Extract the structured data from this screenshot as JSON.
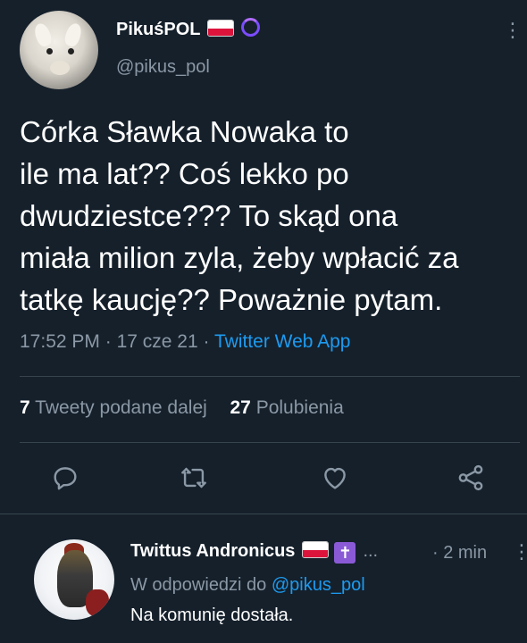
{
  "main_tweet": {
    "author_name": "PikuśPOL",
    "handle": "@pikus_pol",
    "text_lines": [
      "Córka Sławka Nowaka to",
      "ile ma lat?? Coś lekko po",
      "dwudziestce??? To skąd ona",
      "miała milion zyla, żeby wpłacić za",
      "tatkę kaucję?? Poważnie pytam."
    ],
    "time": "17:52 PM",
    "date": "17 cze 21",
    "source_app": "Twitter Web App",
    "separator": "·",
    "retweets_count": "7",
    "retweets_label": "Tweety podane dalej",
    "likes_count": "27",
    "likes_label": "Polubienia"
  },
  "icons": {
    "reply": "reply-icon",
    "retweet": "retweet-icon",
    "like": "heart-icon",
    "share": "share-icon",
    "more": "more-icon",
    "flag": "poland-flag-icon"
  },
  "reply_tweet": {
    "author_name": "Twittus Andronicus",
    "ellipsis": "...",
    "time": "· 2 min",
    "replying_to_label": "W odpowiedzi do",
    "replying_to_handle": "@pikus_pol",
    "text": "Na komunię dostała."
  },
  "colors": {
    "background": "#15202b",
    "accent": "#1d9bf0",
    "secondary_text": "#8b98a5",
    "divider": "#38444d"
  }
}
